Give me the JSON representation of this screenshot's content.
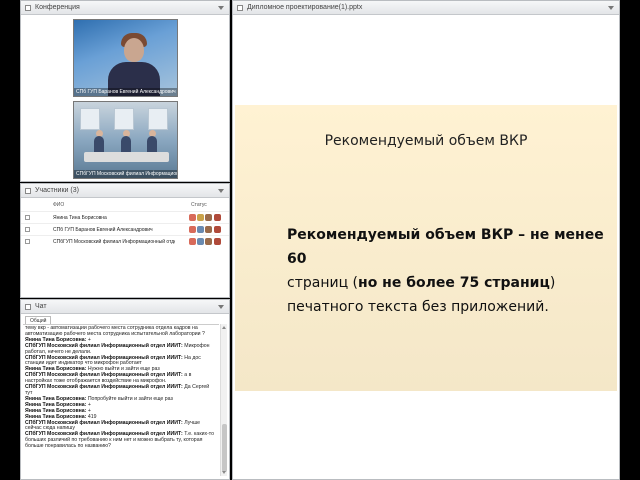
{
  "conference": {
    "title": "Конференция",
    "video1_caption": "СПб ГУП Баранов Евгений Александрович",
    "video2_caption": "СПбГУП Московский филиал Информацион..."
  },
  "participants": {
    "title": "Участники (3)",
    "col_name": "ФИО",
    "col_status": "Статус",
    "rows": [
      {
        "name": "Янина Тина Борисовна"
      },
      {
        "name": "СПб ГУП Баранов Евгений Александрович"
      },
      {
        "name": "СПбГУП Московский филиал Информационный отде..."
      }
    ]
  },
  "chat": {
    "title": "Чат",
    "tab": "Общий",
    "messages": [
      {
        "author": "",
        "text": "тему вкр - автоматизации рабочего места сотрудника отдела кадров на автоматизацию рабочего места сотрудника испытательной лаборатории ?"
      },
      {
        "author": "Янина Тина Борисовна:",
        "text": "+"
      },
      {
        "author": "СПбГУП Московский филиал Информационный отдел ИИИТ:",
        "text": "Микрофон работал, ничего не делали."
      },
      {
        "author": "СПбГУП Московский филиал Информационный отдел ИИИТ:",
        "text": "На дос станции идет индикатор что микрофон работает"
      },
      {
        "author": "Янина Тина Борисовна:",
        "text": "Нужно выйти и зайти еще раз"
      },
      {
        "author": "СПбГУП Московский филиал Информационный отдел ИИИТ:",
        "text": "а в настройках тоже отображается воздействие на микрофон."
      },
      {
        "author": "СПбГУП Московский филиал Информационный отдел ИИИТ:",
        "text": "Да Сергей тут"
      },
      {
        "author": "Янина Тина Борисовна:",
        "text": "Попробуйте выйти и зайти еще раз"
      },
      {
        "author": "Янина Тина Борисовна:",
        "text": "+"
      },
      {
        "author": "Янина Тина Борисовна:",
        "text": "+"
      },
      {
        "author": "Янина Тина Борисовна:",
        "text": "419"
      },
      {
        "author": "СПбГУП Московский филиал Информационный отдел ИИИТ:",
        "text": "Лучше сейчас сюда напишу"
      },
      {
        "author": "СПбГУП Московский филиал Информационный отдел ИИИТ:",
        "text": "Т.е. каких-то больших различий по требованию к ним нет и можно выбрать ту, которая больше понравилась по названию?"
      }
    ]
  },
  "presentation": {
    "title": "Дипломное проектирование(1).pptx",
    "slide_title": "Рекомендуемый объем ВКР",
    "text_bold1": "Рекомендуемый объем ВКР – не менее 60",
    "text_plain1": "страниц (",
    "text_bold2": "но не более 75 страниц",
    "text_plain2": ") печатного текста без приложений."
  },
  "colors": {
    "slide_bg": "#f4e7c8",
    "panel_border": "#b9bcc0",
    "background": "#000000"
  }
}
